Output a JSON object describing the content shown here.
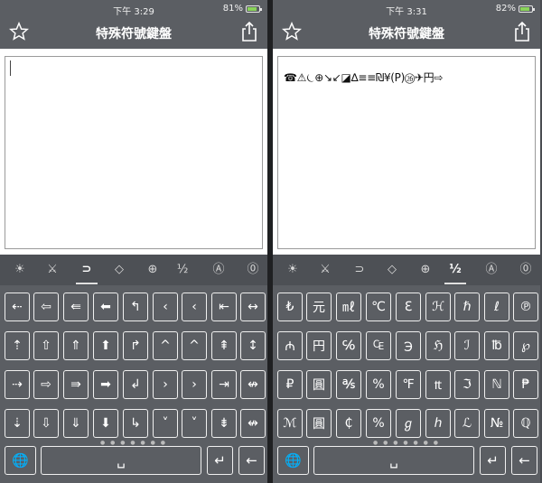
{
  "left": {
    "time": "下午 3:29",
    "battery": "81%",
    "title": "特殊符號鍵盤",
    "editor_text": "",
    "categories": [
      "☀",
      "⚔",
      "⊃",
      "◇",
      "⊕",
      "½",
      "Ⓐ",
      "⓪"
    ],
    "active_category": 2,
    "rows": [
      [
        "⇠",
        "⇦",
        "⇚",
        "⬅",
        "↰",
        "‹",
        "‹",
        "⇤",
        "↔"
      ],
      [
        "⇡",
        "⇧",
        "⇑",
        "⬆",
        "↱",
        "^",
        "^",
        "⇞",
        "↕"
      ],
      [
        "⇢",
        "⇨",
        "⇛",
        "➡",
        "↲",
        "›",
        "›",
        "⇥",
        "↮"
      ],
      [
        "⇣",
        "⇩",
        "⇓",
        "⬇",
        "↳",
        "˅",
        "˅",
        "⇟",
        "↮"
      ]
    ],
    "space_label": "␣",
    "return_label": "↵",
    "delete_label": "←",
    "globe_label": "🌐"
  },
  "right": {
    "time": "下午 3:31",
    "battery": "82%",
    "title": "特殊符號鍵盤",
    "editor_text": "☎⚠⏾⊕↘↙◪∆≡≡₪¥(P)㉖✈円⇨",
    "categories": [
      "☀",
      "⚔",
      "⊃",
      "◇",
      "⊕",
      "½",
      "Ⓐ",
      "⓪"
    ],
    "active_category": 5,
    "rows": [
      [
        "₺",
        "元",
        "㎖",
        "℃",
        "ℇ",
        "ℋ",
        "ℏ",
        "ℓ",
        "℗"
      ],
      [
        "₼",
        "円",
        "℅",
        "₠",
        "℈",
        "ℌ",
        "ℐ",
        "℔",
        "℘"
      ],
      [
        "₽",
        "圓",
        "℁",
        "%",
        "℉",
        "₶",
        "ℑ",
        "ℕ",
        "₱"
      ],
      [
        "ℳ",
        "圓",
        "₵",
        "%",
        "ℊ",
        "ℎ",
        "ℒ",
        "№",
        "ℚ"
      ]
    ],
    "space_label": "␣",
    "return_label": "↵",
    "delete_label": "←",
    "globe_label": "🌐"
  }
}
